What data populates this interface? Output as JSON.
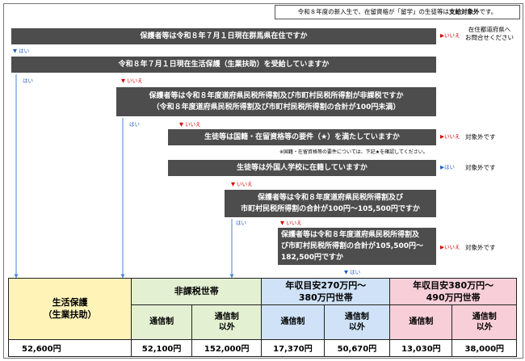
{
  "note": {
    "prefix": "令和８年度の新入生で、在留資格が「留学」の生徒等は",
    "highlight": "支給対象外",
    "suffix": "です。"
  },
  "q1": {
    "text": "保護者等は令和８年７月１日現在群馬県在住ですか"
  },
  "q2": {
    "text": "令和８年７月１日現在生活保護（生業扶助）を受給していますか"
  },
  "q3": {
    "line1": "保護者等は令和８年度道府県民税所得割及び市町村民税所得割が非課税ですか",
    "line2": "（令和８年度道府県民税所得割及び市町村民税所得割の合計が100円未満）"
  },
  "q4": {
    "text": "生徒等は国籍・在留資格等の要件（★）を満たしていますか"
  },
  "q4_note": "※国籍・在留資格等の要件については、下記★を確認してください。",
  "q5": {
    "text": "生徒等は外国人学校に在籍していますか"
  },
  "q6": {
    "line1": "保護者等は令和８年度道府県民税所得割及び",
    "line2": "市町村民税所得割の合計が100円～105,500円ですか"
  },
  "q7": {
    "line1": "保護者等は令和８年度道府県民税所得割及",
    "line2": "び市町村民税所得割の合計が105,500円～",
    "line3": "182,500円ですか"
  },
  "labels": {
    "yes": "はい",
    "no": "いいえ",
    "arrow_no": "▶いいえ",
    "arrow_yes": "▶はい",
    "down_yes": "▼ はい",
    "down_no": "▼ いいえ"
  },
  "outcomes": {
    "q1_no_line1": "在住都道府県へ",
    "q1_no_line2": "お問合せください",
    "not_eligible": "対象外です"
  },
  "table": {
    "col1": {
      "line1": "生活保護",
      "line2": "（生業扶助）"
    },
    "col2": {
      "title": "非課税世帯"
    },
    "col3": {
      "line1": "年収目安270万円～",
      "line2": "380万円世帯"
    },
    "col4": {
      "line1": "年収目安380万円～",
      "line2": "490万円世帯"
    },
    "sub": {
      "tsushin": "通信制",
      "tsushin_igai_1": "通信制",
      "tsushin_igai_2": "以外"
    },
    "amounts": [
      "52,600円",
      "52,100円",
      "152,000円",
      "17,370円",
      "50,670円",
      "13,030円",
      "38,000円"
    ]
  }
}
